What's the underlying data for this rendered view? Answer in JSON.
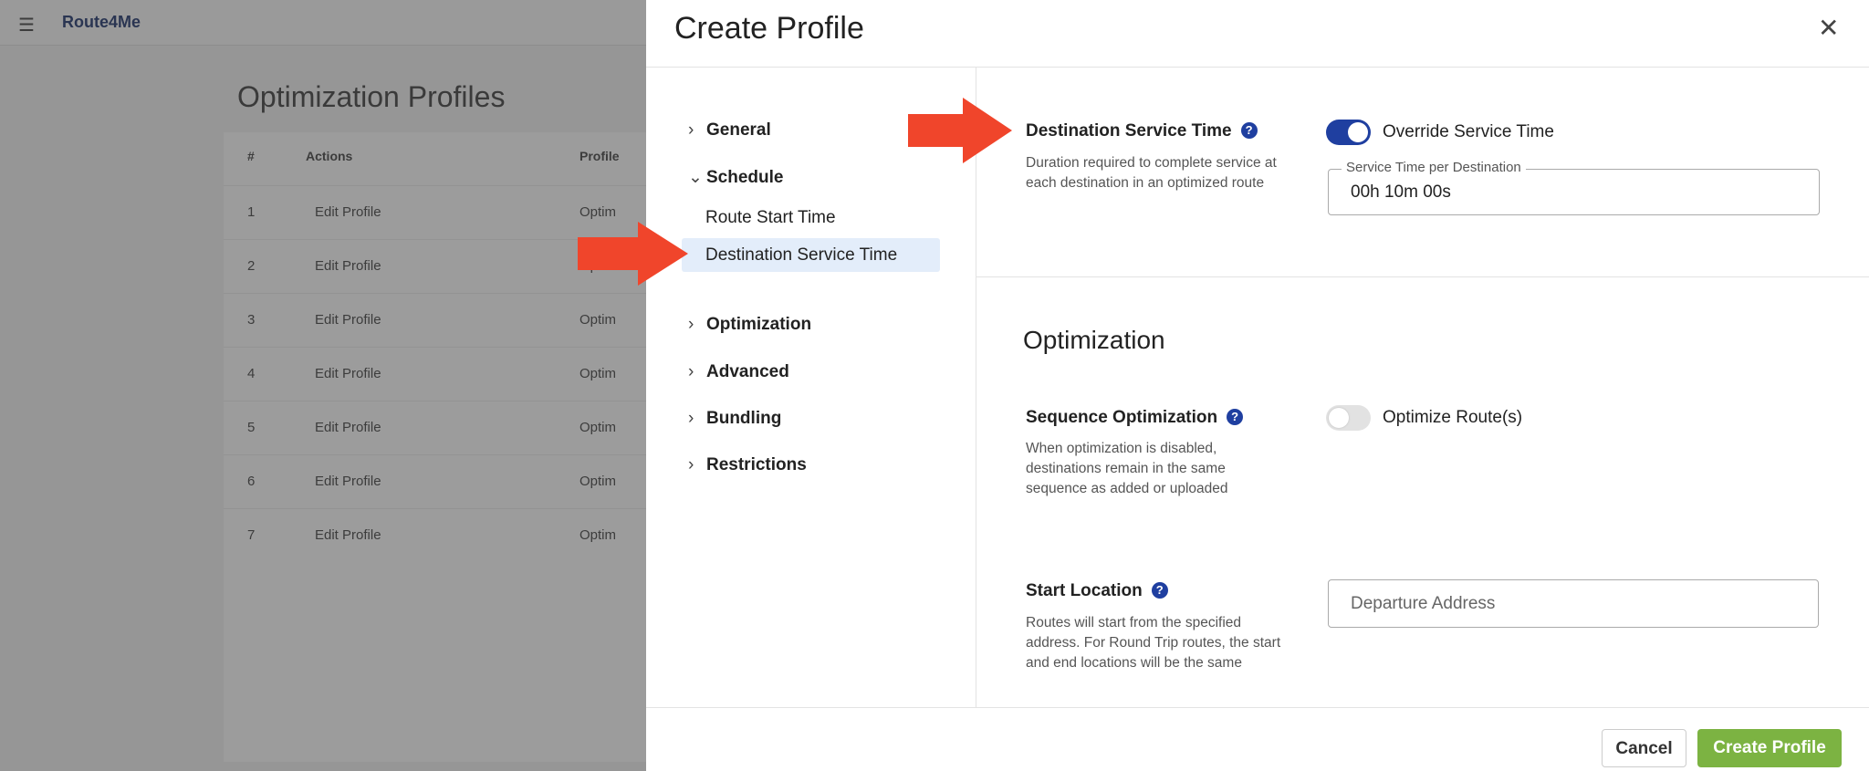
{
  "background": {
    "app_logo": "Route4Me",
    "page_title": "Optimization Profiles",
    "columns": [
      "#",
      "Actions",
      "Profile"
    ],
    "rows": [
      {
        "id": "1",
        "action": "Edit Profile",
        "profile": "Optim"
      },
      {
        "id": "2",
        "action": "Edit Profile",
        "profile": "Optim"
      },
      {
        "id": "3",
        "action": "Edit Profile",
        "profile": "Optim"
      },
      {
        "id": "4",
        "action": "Edit Profile",
        "profile": "Optim"
      },
      {
        "id": "5",
        "action": "Edit Profile",
        "profile": "Optim"
      },
      {
        "id": "6",
        "action": "Edit Profile",
        "profile": "Optim"
      },
      {
        "id": "7",
        "action": "Edit Profile",
        "profile": "Optim"
      }
    ]
  },
  "modal": {
    "title": "Create Profile",
    "close_icon": "close-icon",
    "nav": {
      "general": "General",
      "schedule": "Schedule",
      "route_start_time": "Route Start Time",
      "destination_service_time": "Destination Service Time",
      "optimization": "Optimization",
      "advanced": "Advanced",
      "bundling": "Bundling",
      "restrictions": "Restrictions"
    },
    "service_time": {
      "label": "Destination Service Time",
      "description": "Duration required to complete service at each destination in an optimized route",
      "toggle_label": "Override Service Time",
      "toggle_on": true,
      "field_label": "Service Time per Destination",
      "value": "00h 10m 00s"
    },
    "optimization": {
      "heading": "Optimization",
      "sequence": {
        "label": "Sequence Optimization",
        "description": "When optimization is disabled, destinations remain in the same sequence as added or uploaded",
        "toggle_label": "Optimize Route(s)",
        "toggle_on": false
      },
      "start_location": {
        "label": "Start Location",
        "description": "Routes will start from the specified address. For Round Trip routes, the start and end locations will be the same",
        "placeholder": "Departure Address"
      }
    },
    "footer": {
      "cancel": "Cancel",
      "create": "Create Profile"
    }
  },
  "colors": {
    "accent": "#1f3fa0",
    "create_button": "#7cb342",
    "arrow": "#f0452b",
    "nav_active": "#e3edfa"
  }
}
